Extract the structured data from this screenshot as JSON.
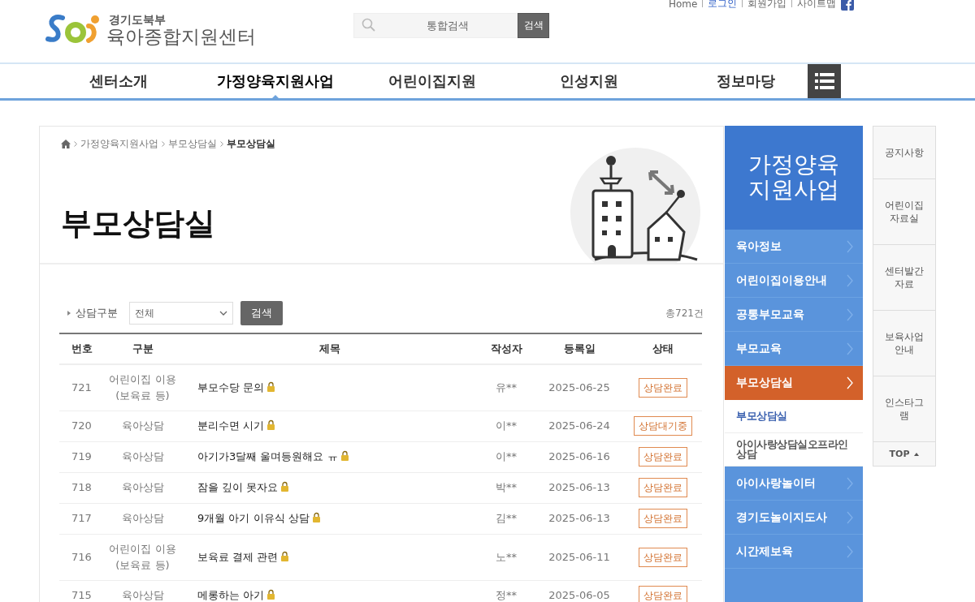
{
  "header": {
    "logo": {
      "subtitle": "경기도북부",
      "title": "육아종합지원센터"
    },
    "search": {
      "placeholder": "통합검색",
      "button": "검색"
    },
    "top_links": [
      {
        "label": "Home",
        "highlighted": false
      },
      {
        "label": "로그인",
        "highlighted": true
      },
      {
        "label": "회원가입",
        "highlighted": false
      },
      {
        "label": "사이트맵",
        "highlighted": false
      }
    ]
  },
  "nav": {
    "items": [
      {
        "label": "센터소개",
        "selected": false
      },
      {
        "label": "가정양육지원사업",
        "selected": true
      },
      {
        "label": "어린이집지원",
        "selected": false
      },
      {
        "label": "인성지원",
        "selected": false
      },
      {
        "label": "정보마당",
        "selected": false
      }
    ]
  },
  "breadcrumb": [
    {
      "label": "가정양육지원사업",
      "current": false
    },
    {
      "label": "부모상담실",
      "current": false
    },
    {
      "label": "부모상담실",
      "current": true
    }
  ],
  "page_title": "부모상담실",
  "filter": {
    "label": "상담구분",
    "select": "전체",
    "button": "검색",
    "total": "총721건"
  },
  "table": {
    "columns": [
      "번호",
      "구분",
      "제목",
      "작성자",
      "등록일",
      "상태"
    ],
    "rows": [
      {
        "number": "721",
        "category": "어린이집 이용\n(보육료 등)",
        "title": "부모수당 문의",
        "locked": true,
        "author": "유**",
        "date": "2025-06-25",
        "status": "상담완료"
      },
      {
        "number": "720",
        "category": "육아상담",
        "title": "분리수면 시기",
        "locked": true,
        "author": "이**",
        "date": "2025-06-24",
        "status": "상담대기중"
      },
      {
        "number": "719",
        "category": "육아상담",
        "title": "아기가3달째 울며등원해요 ㅠ",
        "locked": true,
        "author": "이**",
        "date": "2025-06-16",
        "status": "상담완료"
      },
      {
        "number": "718",
        "category": "육아상담",
        "title": "잠을 깊이 못자요",
        "locked": true,
        "author": "박**",
        "date": "2025-06-13",
        "status": "상담완료"
      },
      {
        "number": "717",
        "category": "육아상담",
        "title": "9개월 아기 이유식 상담",
        "locked": true,
        "author": "김**",
        "date": "2025-06-13",
        "status": "상담완료"
      },
      {
        "number": "716",
        "category": "어린이집 이용\n(보육료 등)",
        "title": "보육료 결제 관련",
        "locked": true,
        "author": "노**",
        "date": "2025-06-11",
        "status": "상담완료"
      },
      {
        "number": "715",
        "category": "육아상담",
        "title": "메롱하는 아기",
        "locked": true,
        "author": "정**",
        "date": "2025-06-05",
        "status": "상담완료"
      }
    ]
  },
  "sidebar": {
    "title": "가정양육\n지원사업",
    "items": [
      {
        "label": "육아정보",
        "selected": false
      },
      {
        "label": "어린이집이용안내",
        "selected": false
      },
      {
        "label": "공통부모교육",
        "selected": false
      },
      {
        "label": "부모교육",
        "selected": false
      },
      {
        "label": "부모상담실",
        "selected": true,
        "children": [
          {
            "label": "부모상담실",
            "selected": true
          },
          {
            "label": "아이사랑상담실오프라인\n상담",
            "selected": false
          }
        ]
      },
      {
        "label": "아이사랑놀이터",
        "selected": false
      },
      {
        "label": "경기도놀이지도사",
        "selected": false
      },
      {
        "label": "시간제보육",
        "selected": false
      }
    ]
  },
  "quick_links": {
    "items": [
      "공지사항",
      "어린이집\n자료실",
      "센터발간\n자료",
      "보육사업\n안내",
      "인스타그\n램"
    ],
    "top": "TOP"
  }
}
